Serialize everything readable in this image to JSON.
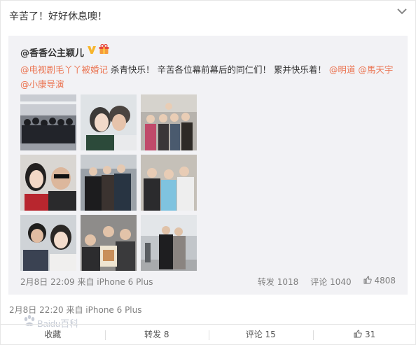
{
  "post": {
    "text": "辛苦了！好好休息噢！"
  },
  "repost": {
    "author": "@香香公主颖儿",
    "text_parts": [
      {
        "t": "@电视剧毛丫丫被婚记",
        "link": true
      },
      {
        "t": " 杀青快乐！ 辛苦各位幕前幕后的同仁们！ 累并快乐着！ ",
        "link": false
      },
      {
        "t": "@明道",
        "link": true
      },
      {
        "t": " ",
        "link": false
      },
      {
        "t": "@馬天宇",
        "link": true
      },
      {
        "t": " ",
        "link": false
      },
      {
        "t": "@小康导演",
        "link": true
      }
    ],
    "meta": "2月8日 22:09 来自 iPhone 6 Plus",
    "actions": {
      "forward": "转发 1018",
      "comment": "评论 1040",
      "like": "4808"
    }
  },
  "post_meta": "2月8日 22:20 来自 iPhone 6 Plus",
  "footer": {
    "collect": "收藏",
    "forward": "转发 8",
    "comment": "评论 15",
    "like": "31"
  },
  "watermark": "Baidu百科",
  "colors": {
    "link": "#eb7350",
    "repost_bg": "#f2f2f5",
    "badge_v": "#f7b52c",
    "meta": "#808080"
  },
  "icons": {
    "menu": "chevron-down-icon",
    "verified": "verified-v-icon",
    "gift": "gift-icon",
    "like": "thumbs-up-icon"
  },
  "photos": [
    {
      "name": "photo-group-crew"
    },
    {
      "name": "photo-two-women"
    },
    {
      "name": "photo-cast-group"
    },
    {
      "name": "photo-woman-and-man"
    },
    {
      "name": "photo-cast-in-coats"
    },
    {
      "name": "photo-cast-trio"
    },
    {
      "name": "photo-selfie-duo"
    },
    {
      "name": "photo-group-with-poster"
    },
    {
      "name": "photo-outdoor-pair"
    }
  ]
}
